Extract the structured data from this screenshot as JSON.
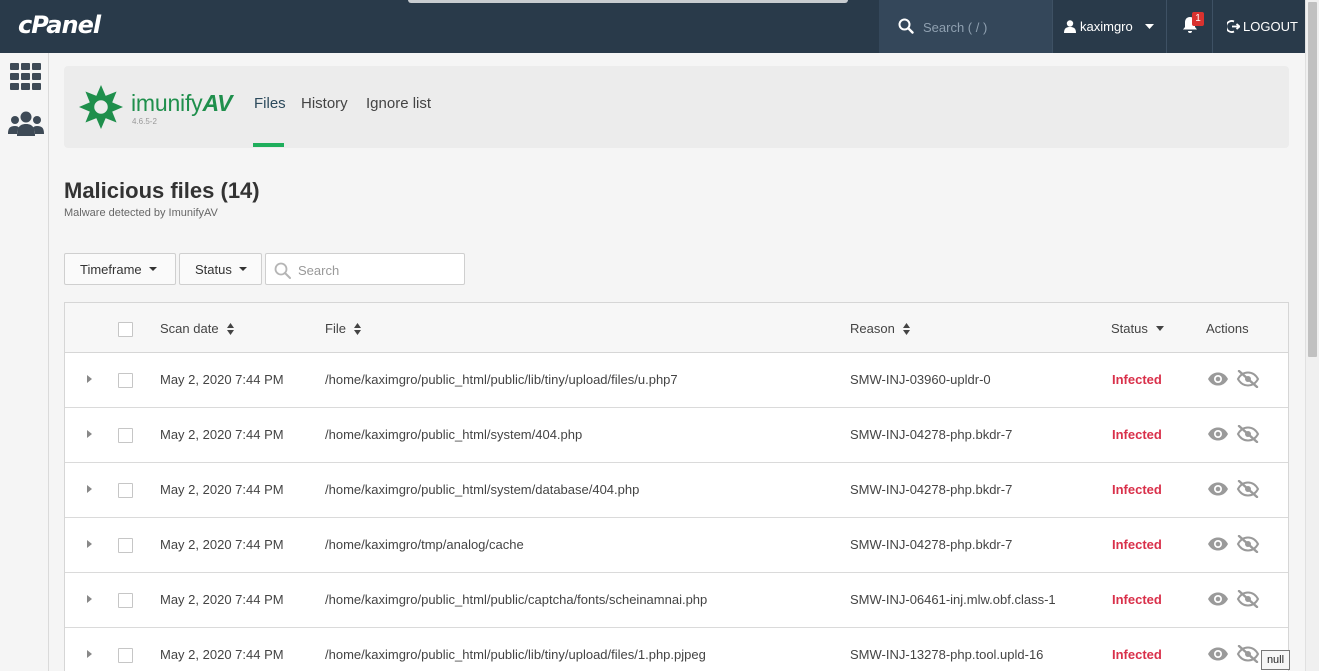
{
  "app": {
    "brand": "cPanel",
    "search_placeholder": "Search ( / )",
    "username": "kaximgro",
    "notifications_count": "1",
    "logout_label": "LOGOUT"
  },
  "sidebar": {
    "icons": [
      "grid-icon",
      "users-icon"
    ]
  },
  "plugin": {
    "logo_text_light": "imunify",
    "logo_text_bold": "AV",
    "version": "4.6.5-2",
    "tabs": [
      {
        "label": "Files",
        "active": true
      },
      {
        "label": "History",
        "active": false
      },
      {
        "label": "Ignore list",
        "active": false
      }
    ]
  },
  "page": {
    "title": "Malicious files (14)",
    "subtitle": "Malware detected by ImunifyAV"
  },
  "filters": {
    "timeframe_label": "Timeframe",
    "status_label": "Status",
    "search_placeholder": "Search"
  },
  "table": {
    "headers": {
      "scan_date": "Scan date",
      "file": "File",
      "reason": "Reason",
      "status": "Status",
      "actions": "Actions"
    },
    "rows": [
      {
        "scan_date": "May 2, 2020 7:44 PM",
        "file": "/home/kaximgro/public_html/public/lib/tiny/upload/files/u.php7",
        "reason": "SMW-INJ-03960-upldr-0",
        "status": "Infected"
      },
      {
        "scan_date": "May 2, 2020 7:44 PM",
        "file": "/home/kaximgro/public_html/system/404.php",
        "reason": "SMW-INJ-04278-php.bkdr-7",
        "status": "Infected"
      },
      {
        "scan_date": "May 2, 2020 7:44 PM",
        "file": "/home/kaximgro/public_html/system/database/404.php",
        "reason": "SMW-INJ-04278-php.bkdr-7",
        "status": "Infected"
      },
      {
        "scan_date": "May 2, 2020 7:44 PM",
        "file": "/home/kaximgro/tmp/analog/cache",
        "reason": "SMW-INJ-04278-php.bkdr-7",
        "status": "Infected"
      },
      {
        "scan_date": "May 2, 2020 7:44 PM",
        "file": "/home/kaximgro/public_html/public/captcha/fonts/scheinamnai.php",
        "reason": "SMW-INJ-06461-inj.mlw.obf.class-1",
        "status": "Infected"
      },
      {
        "scan_date": "May 2, 2020 7:44 PM",
        "file": "/home/kaximgro/public_html/public/lib/tiny/upload/files/1.php.pjpeg",
        "reason": "SMW-INJ-13278-php.tool.upld-16",
        "status": "Infected"
      }
    ]
  },
  "tooltip": "null",
  "colors": {
    "topbar": "#293a4a",
    "accent_green": "#1fae5c",
    "infected_red": "#d9304a"
  }
}
